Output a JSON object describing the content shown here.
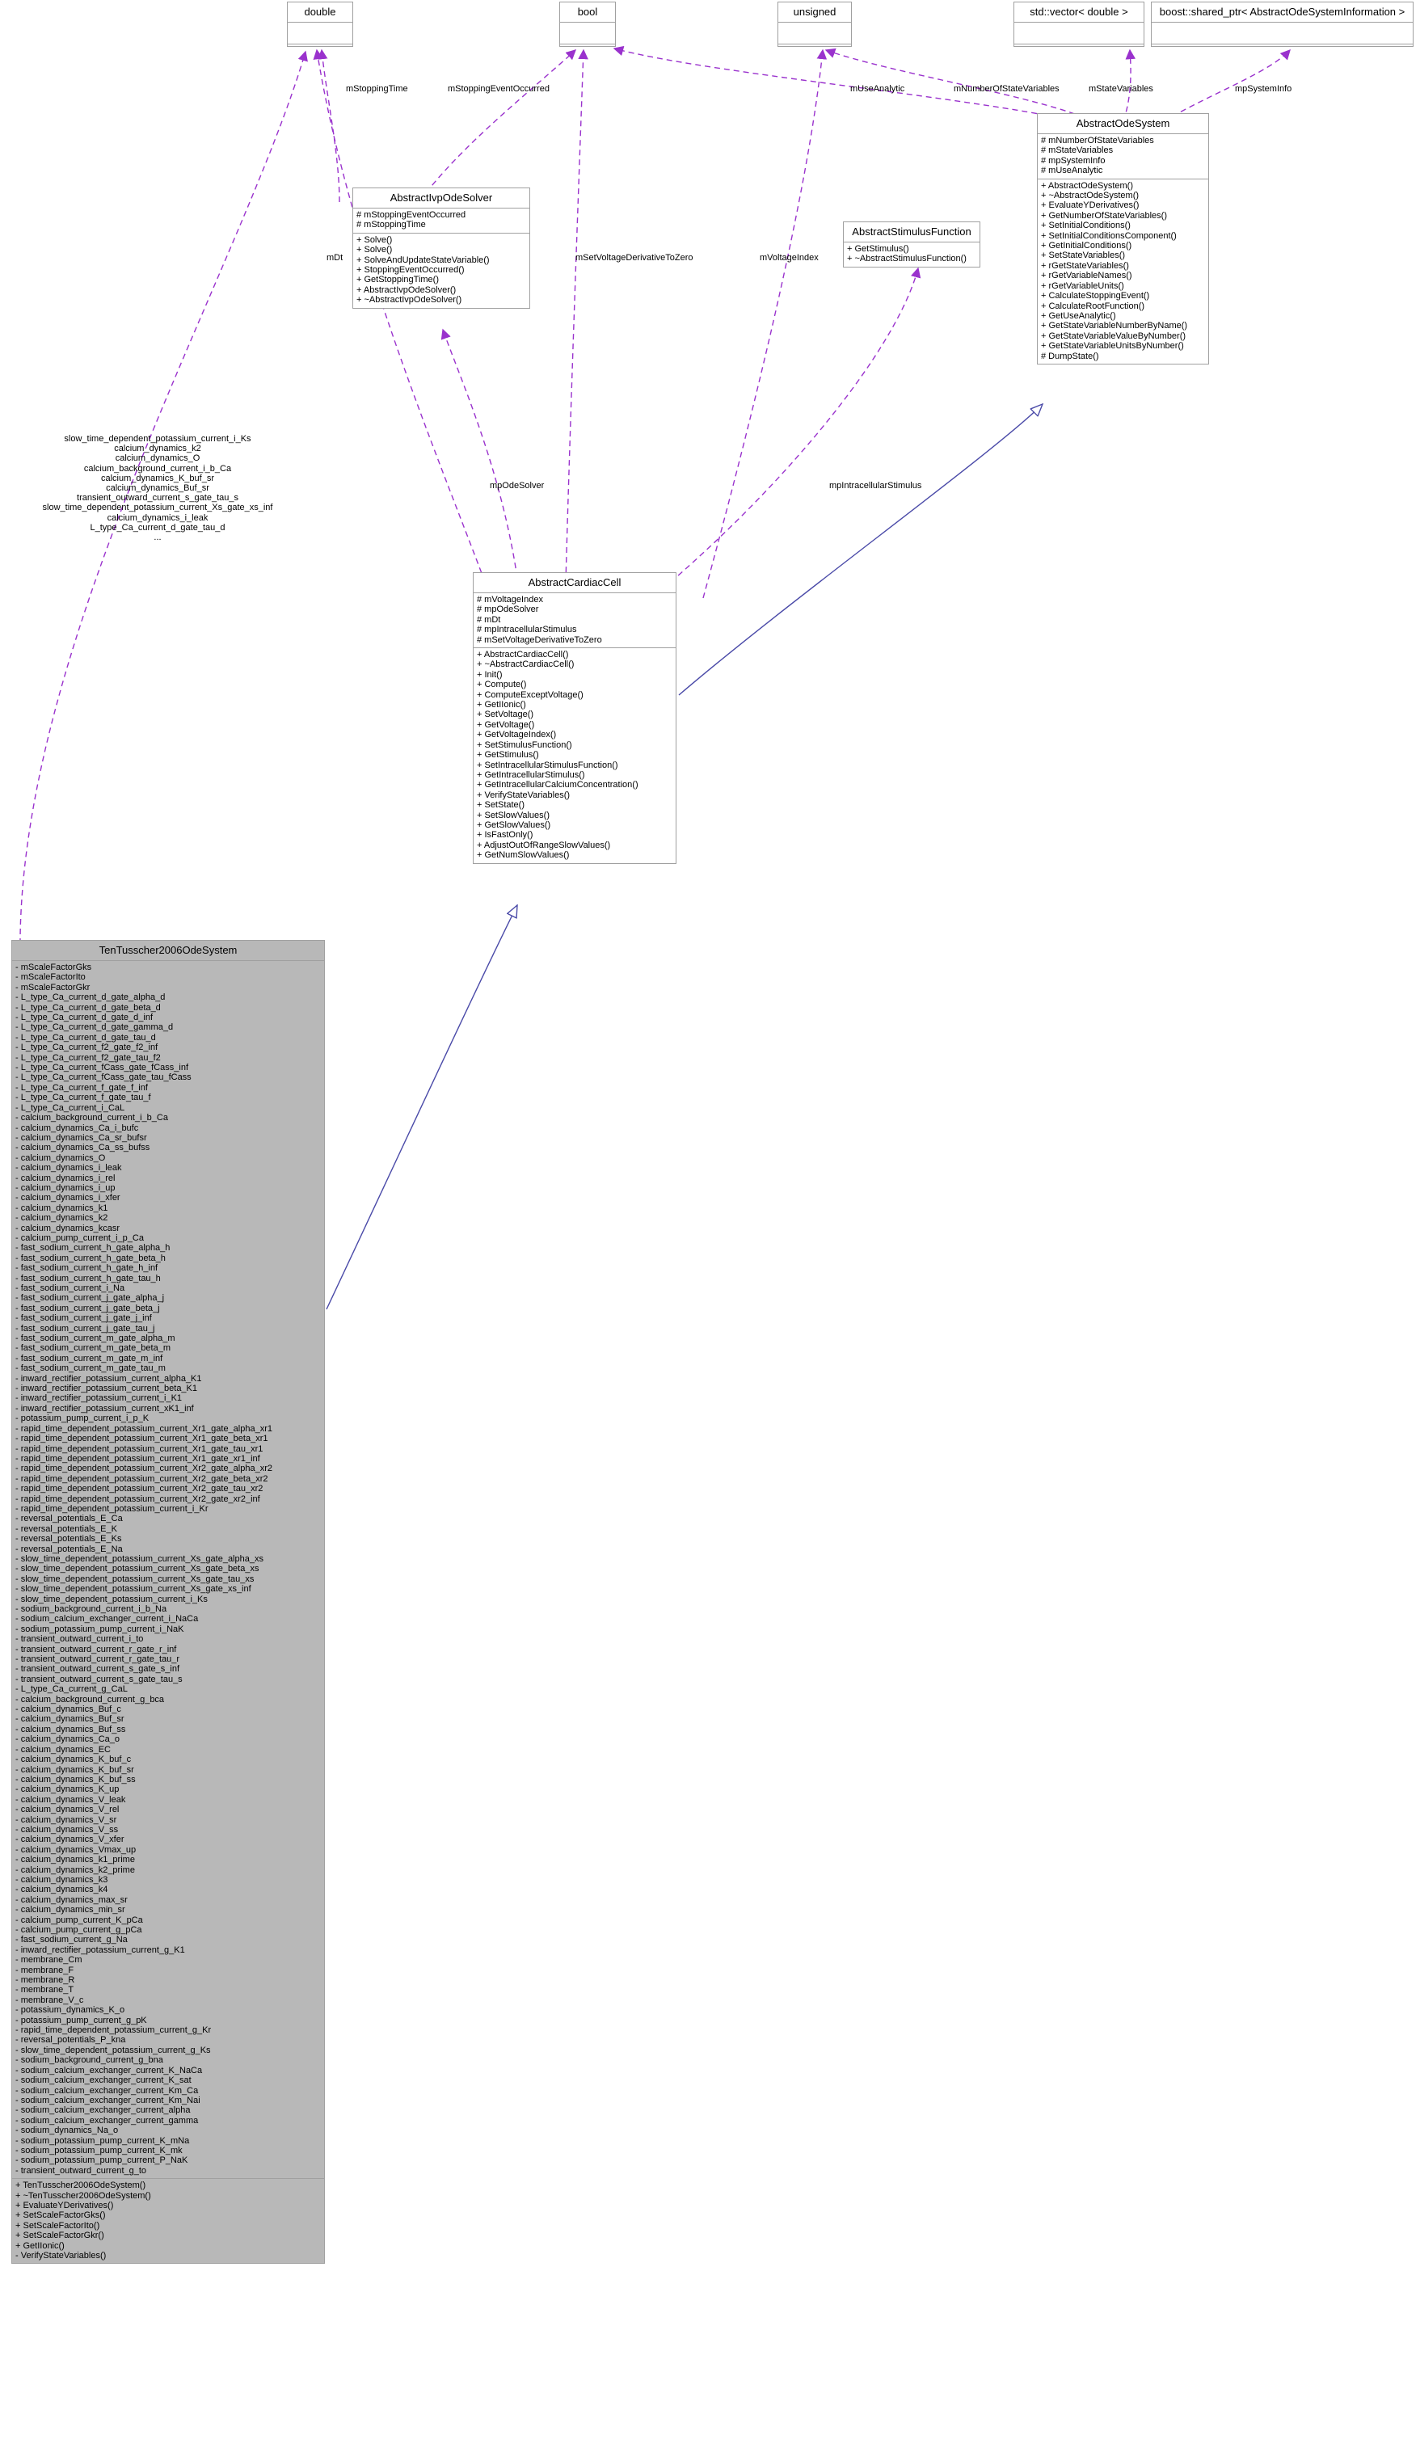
{
  "diagram": {
    "title": "TenTusscher2006OdeSystem class inheritance / collaboration diagram",
    "colors": {
      "usage_edge": "#9a32cd",
      "inherit_edge": "#4a4aa8",
      "node_border": "#a0a0a0",
      "node_fill": "#ffffff",
      "focus_fill": "#b8b8b8"
    }
  },
  "nodes": {
    "double": {
      "title": "double",
      "attributes": [],
      "operations": []
    },
    "bool": {
      "title": "bool",
      "attributes": [],
      "operations": []
    },
    "unsigned": {
      "title": "unsigned",
      "attributes": [],
      "operations": []
    },
    "vector_double": {
      "title": "std::vector< double >",
      "attributes": [],
      "operations": []
    },
    "shared_ptr_info": {
      "title": "boost::shared_ptr< AbstractOdeSystemInformation >",
      "attributes": [],
      "operations": []
    },
    "abstract_ivp_ode_solver": {
      "title": "AbstractIvpOdeSolver",
      "attributes": [
        "# mStoppingEventOccurred",
        "# mStoppingTime"
      ],
      "operations": [
        "+ Solve()",
        "+ Solve()",
        "+ SolveAndUpdateStateVariable()",
        "+ StoppingEventOccurred()",
        "+ GetStoppingTime()",
        "+ AbstractIvpOdeSolver()",
        "+ ~AbstractIvpOdeSolver()"
      ]
    },
    "abstract_stimulus_function": {
      "title": "AbstractStimulusFunction",
      "attributes": [],
      "operations": [
        "+ GetStimulus()",
        "+ ~AbstractStimulusFunction()"
      ]
    },
    "abstract_ode_system": {
      "title": "AbstractOdeSystem",
      "attributes": [
        "# mNumberOfStateVariables",
        "# mStateVariables",
        "# mpSystemInfo",
        "# mUseAnalytic"
      ],
      "operations": [
        "+ AbstractOdeSystem()",
        "+ ~AbstractOdeSystem()",
        "+ EvaluateYDerivatives()",
        "+ GetNumberOfStateVariables()",
        "+ SetInitialConditions()",
        "+ SetInitialConditionsComponent()",
        "+ GetInitialConditions()",
        "+ SetStateVariables()",
        "+ rGetStateVariables()",
        "+ rGetVariableNames()",
        "+ rGetVariableUnits()",
        "+ CalculateStoppingEvent()",
        "+ CalculateRootFunction()",
        "+ GetUseAnalytic()",
        "+ GetStateVariableNumberByName()",
        "+ GetStateVariableValueByNumber()",
        "+ GetStateVariableUnitsByNumber()",
        "# DumpState()"
      ]
    },
    "abstract_cardiac_cell": {
      "title": "AbstractCardiacCell",
      "attributes": [
        "# mVoltageIndex",
        "# mpOdeSolver",
        "# mDt",
        "# mpIntracellularStimulus",
        "# mSetVoltageDerivativeToZero"
      ],
      "operations": [
        "+ AbstractCardiacCell()",
        "+ ~AbstractCardiacCell()",
        "+ Init()",
        "+ Compute()",
        "+ ComputeExceptVoltage()",
        "+ GetIIonic()",
        "+ SetVoltage()",
        "+ GetVoltage()",
        "+ GetVoltageIndex()",
        "+ SetStimulusFunction()",
        "+ GetStimulus()",
        "+ SetIntracellularStimulusFunction()",
        "+ GetIntracellularStimulus()",
        "+ GetIntracellularCalciumConcentration()",
        "+ VerifyStateVariables()",
        "+ SetState()",
        "+ SetSlowValues()",
        "+ GetSlowValues()",
        "+ IsFastOnly()",
        "+ AdjustOutOfRangeSlowValues()",
        "+ GetNumSlowValues()"
      ]
    },
    "ten_tusscher": {
      "title": "TenTusscher2006OdeSystem",
      "attributes": [
        "- mScaleFactorGks",
        "- mScaleFactorIto",
        "- mScaleFactorGkr",
        "- L_type_Ca_current_d_gate_alpha_d",
        "- L_type_Ca_current_d_gate_beta_d",
        "- L_type_Ca_current_d_gate_d_inf",
        "- L_type_Ca_current_d_gate_gamma_d",
        "- L_type_Ca_current_d_gate_tau_d",
        "- L_type_Ca_current_f2_gate_f2_inf",
        "- L_type_Ca_current_f2_gate_tau_f2",
        "- L_type_Ca_current_fCass_gate_fCass_inf",
        "- L_type_Ca_current_fCass_gate_tau_fCass",
        "- L_type_Ca_current_f_gate_f_inf",
        "- L_type_Ca_current_f_gate_tau_f",
        "- L_type_Ca_current_i_CaL",
        "- calcium_background_current_i_b_Ca",
        "- calcium_dynamics_Ca_i_bufc",
        "- calcium_dynamics_Ca_sr_bufsr",
        "- calcium_dynamics_Ca_ss_bufss",
        "- calcium_dynamics_O",
        "- calcium_dynamics_i_leak",
        "- calcium_dynamics_i_rel",
        "- calcium_dynamics_i_up",
        "- calcium_dynamics_i_xfer",
        "- calcium_dynamics_k1",
        "- calcium_dynamics_k2",
        "- calcium_dynamics_kcasr",
        "- calcium_pump_current_i_p_Ca",
        "- fast_sodium_current_h_gate_alpha_h",
        "- fast_sodium_current_h_gate_beta_h",
        "- fast_sodium_current_h_gate_h_inf",
        "- fast_sodium_current_h_gate_tau_h",
        "- fast_sodium_current_i_Na",
        "- fast_sodium_current_j_gate_alpha_j",
        "- fast_sodium_current_j_gate_beta_j",
        "- fast_sodium_current_j_gate_j_inf",
        "- fast_sodium_current_j_gate_tau_j",
        "- fast_sodium_current_m_gate_alpha_m",
        "- fast_sodium_current_m_gate_beta_m",
        "- fast_sodium_current_m_gate_m_inf",
        "- fast_sodium_current_m_gate_tau_m",
        "- inward_rectifier_potassium_current_alpha_K1",
        "- inward_rectifier_potassium_current_beta_K1",
        "- inward_rectifier_potassium_current_i_K1",
        "- inward_rectifier_potassium_current_xK1_inf",
        "- potassium_pump_current_i_p_K",
        "- rapid_time_dependent_potassium_current_Xr1_gate_alpha_xr1",
        "- rapid_time_dependent_potassium_current_Xr1_gate_beta_xr1",
        "- rapid_time_dependent_potassium_current_Xr1_gate_tau_xr1",
        "- rapid_time_dependent_potassium_current_Xr1_gate_xr1_inf",
        "- rapid_time_dependent_potassium_current_Xr2_gate_alpha_xr2",
        "- rapid_time_dependent_potassium_current_Xr2_gate_beta_xr2",
        "- rapid_time_dependent_potassium_current_Xr2_gate_tau_xr2",
        "- rapid_time_dependent_potassium_current_Xr2_gate_xr2_inf",
        "- rapid_time_dependent_potassium_current_i_Kr",
        "- reversal_potentials_E_Ca",
        "- reversal_potentials_E_K",
        "- reversal_potentials_E_Ks",
        "- reversal_potentials_E_Na",
        "- slow_time_dependent_potassium_current_Xs_gate_alpha_xs",
        "- slow_time_dependent_potassium_current_Xs_gate_beta_xs",
        "- slow_time_dependent_potassium_current_Xs_gate_tau_xs",
        "- slow_time_dependent_potassium_current_Xs_gate_xs_inf",
        "- slow_time_dependent_potassium_current_i_Ks",
        "- sodium_background_current_i_b_Na",
        "- sodium_calcium_exchanger_current_i_NaCa",
        "- sodium_potassium_pump_current_i_NaK",
        "- transient_outward_current_i_to",
        "- transient_outward_current_r_gate_r_inf",
        "- transient_outward_current_r_gate_tau_r",
        "- transient_outward_current_s_gate_s_inf",
        "- transient_outward_current_s_gate_tau_s",
        "- L_type_Ca_current_g_CaL",
        "- calcium_background_current_g_bca",
        "- calcium_dynamics_Buf_c",
        "- calcium_dynamics_Buf_sr",
        "- calcium_dynamics_Buf_ss",
        "- calcium_dynamics_Ca_o",
        "- calcium_dynamics_EC",
        "- calcium_dynamics_K_buf_c",
        "- calcium_dynamics_K_buf_sr",
        "- calcium_dynamics_K_buf_ss",
        "- calcium_dynamics_K_up",
        "- calcium_dynamics_V_leak",
        "- calcium_dynamics_V_rel",
        "- calcium_dynamics_V_sr",
        "- calcium_dynamics_V_ss",
        "- calcium_dynamics_V_xfer",
        "- calcium_dynamics_Vmax_up",
        "- calcium_dynamics_k1_prime",
        "- calcium_dynamics_k2_prime",
        "- calcium_dynamics_k3",
        "- calcium_dynamics_k4",
        "- calcium_dynamics_max_sr",
        "- calcium_dynamics_min_sr",
        "- calcium_pump_current_K_pCa",
        "- calcium_pump_current_g_pCa",
        "- fast_sodium_current_g_Na",
        "- inward_rectifier_potassium_current_g_K1",
        "- membrane_Cm",
        "- membrane_F",
        "- membrane_R",
        "- membrane_T",
        "- membrane_V_c",
        "- potassium_dynamics_K_o",
        "- potassium_pump_current_g_pK",
        "- rapid_time_dependent_potassium_current_g_Kr",
        "- reversal_potentials_P_kna",
        "- slow_time_dependent_potassium_current_g_Ks",
        "- sodium_background_current_g_bna",
        "- sodium_calcium_exchanger_current_K_NaCa",
        "- sodium_calcium_exchanger_current_K_sat",
        "- sodium_calcium_exchanger_current_Km_Ca",
        "- sodium_calcium_exchanger_current_Km_Nai",
        "- sodium_calcium_exchanger_current_alpha",
        "- sodium_calcium_exchanger_current_gamma",
        "- sodium_dynamics_Na_o",
        "- sodium_potassium_pump_current_K_mNa",
        "- sodium_potassium_pump_current_K_mk",
        "- sodium_potassium_pump_current_P_NaK",
        "- transient_outward_current_g_to"
      ],
      "operations": [
        "+ TenTusscher2006OdeSystem()",
        "+ ~TenTusscher2006OdeSystem()",
        "+ EvaluateYDerivatives()",
        "+ SetScaleFactorGks()",
        "+ SetScaleFactorIto()",
        "+ SetScaleFactorGkr()",
        "+ GetIIonic()",
        "- VerifyStateVariables()"
      ]
    }
  },
  "edge_labels": {
    "m_stopping_time": "mStoppingTime",
    "m_stopping_event_occurred": "mStoppingEventOccurred",
    "m_use_analytic": "mUseAnalytic",
    "m_number_of_state_variables": "mNumberOfStateVariables",
    "m_state_variables": "mStateVariables",
    "mp_system_info": "mpSystemInfo",
    "m_dt": "mDt",
    "mp_ode_solver": "mpOdeSolver",
    "m_set_voltage_derivative_to_zero": "mSetVoltageDerivativeToZero",
    "m_voltage_index": "mVoltageIndex",
    "mp_intracellular_stimulus": "mpIntracellularStimulus",
    "ten_tusscher_double_fields": "slow_time_dependent_potassium_current_i_Ks\ncalcium_dynamics_k2\ncalcium_dynamics_O\ncalcium_background_current_i_b_Ca\ncalcium_dynamics_K_buf_sr\ncalcium_dynamics_Buf_sr\ntransient_outward_current_s_gate_tau_s\nslow_time_dependent_potassium_current_Xs_gate_xs_inf\ncalcium_dynamics_i_leak\nL_type_Ca_current_d_gate_tau_d\n..."
  }
}
